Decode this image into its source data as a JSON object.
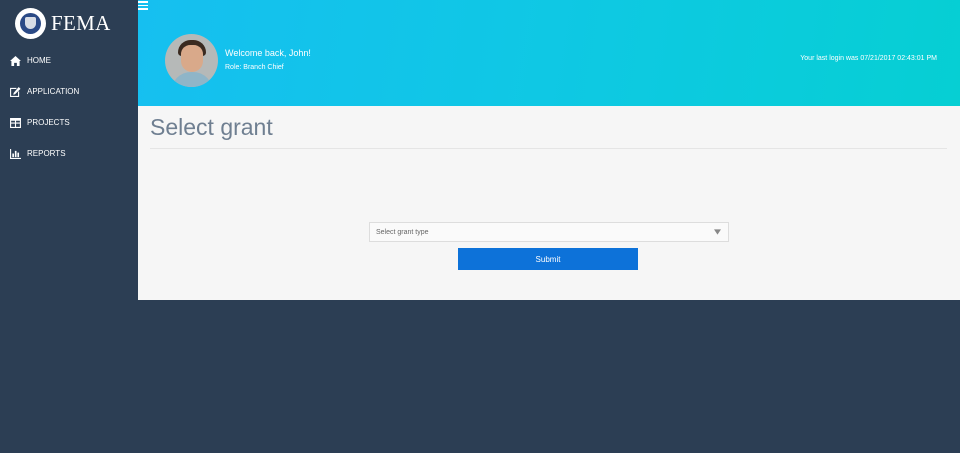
{
  "brand": {
    "name": "FEMA"
  },
  "nav": {
    "items": [
      {
        "label": "HOME",
        "icon": "home-icon"
      },
      {
        "label": "APPLICATION",
        "icon": "edit-icon"
      },
      {
        "label": "PROJECTS",
        "icon": "table-icon"
      },
      {
        "label": "REPORTS",
        "icon": "bar-chart-icon"
      }
    ]
  },
  "header": {
    "menu_icon": "hamburger-icon",
    "welcome": "Welcome back, John!",
    "role": "Role: Branch Chief",
    "last_login": "Your last login was 07/21/2017 02:43:01 PM"
  },
  "main": {
    "title": "Select grant",
    "select": {
      "value": "Select grant type",
      "icon": "dropdown-arrow-icon"
    },
    "submit_label": "Submit"
  },
  "colors": {
    "sidebar": "#2c3e54",
    "header_gradient_start": "#16bff0",
    "header_gradient_end": "#06cfd3",
    "primary_button": "#0d72d9",
    "content_bg": "#f6f6f6"
  }
}
